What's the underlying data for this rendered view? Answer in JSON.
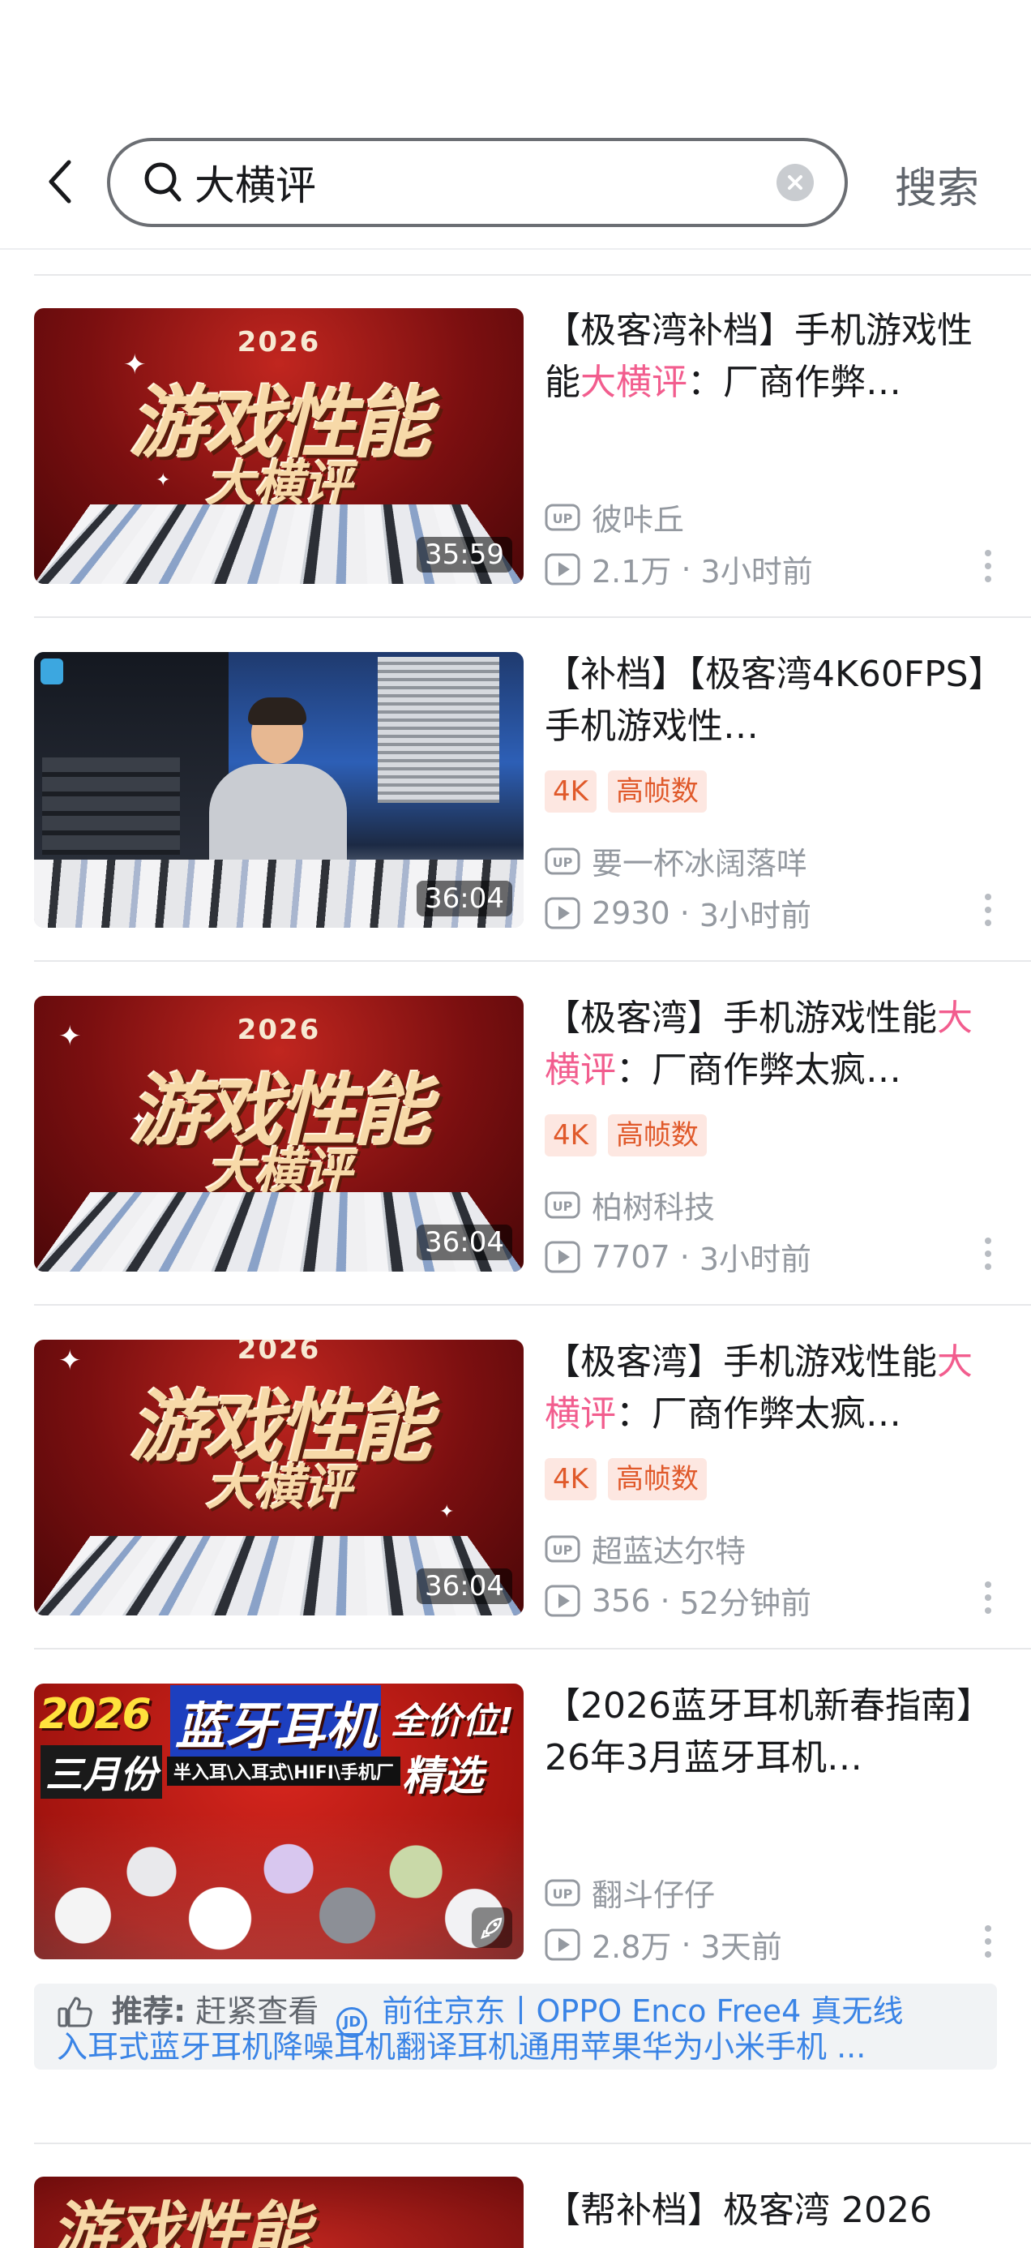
{
  "search": {
    "query": "大横评",
    "submit_label": "搜索"
  },
  "results": [
    {
      "thumb_year": "2026",
      "thumb_big": "游戏性能",
      "thumb_sub": "大横评",
      "duration": "35:59",
      "title_pre": "【极客湾补档】手机游戏性能",
      "title_hl": "大横评",
      "title_post": "：厂商作弊…",
      "tags": [],
      "uploader": "彼咔丘",
      "views": "2.1万",
      "time": "3小时前"
    },
    {
      "duration": "36:04",
      "title_pre": "【补档】【极客湾4K60FPS】手机游戏性…",
      "title_hl": "",
      "title_post": "",
      "tags": [
        "4K",
        "高帧数"
      ],
      "uploader": "要一杯冰阔落咩",
      "views": "2930",
      "time": "3小时前"
    },
    {
      "thumb_year": "2026",
      "thumb_big": "游戏性能",
      "thumb_sub": "大横评",
      "duration": "36:04",
      "title_pre": "【极客湾】手机游戏性能",
      "title_hl": "大横评",
      "title_post": "：厂商作弊太疯…",
      "tags": [
        "4K",
        "高帧数"
      ],
      "uploader": "柏树科技",
      "views": "7707",
      "time": "3小时前"
    },
    {
      "thumb_year": "2026",
      "thumb_big": "游戏性能",
      "thumb_sub": "大横评",
      "duration": "36:04",
      "title_pre": "【极客湾】手机游戏性能",
      "title_hl": "大横评",
      "title_post": "：厂商作弊太疯…",
      "tags": [
        "4K",
        "高帧数"
      ],
      "uploader": "超蓝达尔特",
      "views": "356",
      "time": "52分钟前"
    },
    {
      "thumb_line1a": "2026",
      "thumb_line1b": "蓝牙耳机",
      "thumb_line1c": "全价位!",
      "thumb_line2a": "三月份",
      "thumb_line2b": "半入耳\\入耳式\\HIFI\\手机厂",
      "thumb_line2c": "精选",
      "title_pre": "【2026蓝牙耳机新春指南】26年3月蓝牙耳机…",
      "title_hl": "",
      "title_post": "",
      "tags": [],
      "uploader": "翻斗仔仔",
      "views": "2.8万",
      "time": "3天前"
    }
  ],
  "recommend": {
    "label": "推荐:",
    "lead": "赶紧查看",
    "jd_icon_text": "JD",
    "link_line1": "前往京东丨OPPO Enco Free4 真无线",
    "link_line2": "入耳式蓝牙耳机降噪耳机翻译耳机通用苹果华为小米手机 ..."
  },
  "next_card": {
    "title": "【帮补档】极客湾 2026",
    "thumb_big": "游戏性能"
  },
  "meta_separator": "·",
  "colors": {
    "highlight": "#f25d8e",
    "tag_text": "#e0592a",
    "tag_bg": "#fde7e1",
    "link": "#3a84e6",
    "meta": "#9499a0"
  },
  "icons": {
    "back": "chevron-left-icon",
    "search": "magnifier-icon",
    "clear": "clear-x-icon",
    "uploader": "up-badge-icon",
    "views": "play-count-icon",
    "more": "more-vertical-icon",
    "recommend": "thumbs-up-icon",
    "jd": "jd-logo-icon",
    "rocket": "rocket-icon"
  }
}
